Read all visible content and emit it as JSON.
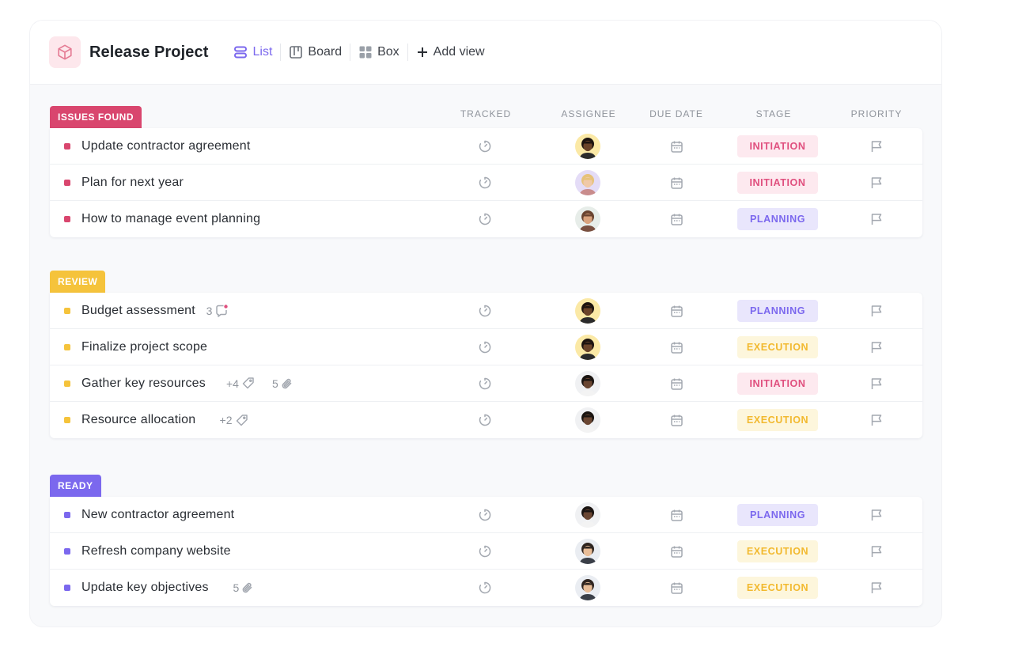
{
  "project": {
    "title": "Release Project"
  },
  "views": [
    {
      "label": "List",
      "icon": "list-icon",
      "active": true
    },
    {
      "label": "Board",
      "icon": "board-icon",
      "active": false
    },
    {
      "label": "Box",
      "icon": "box-icon",
      "active": false
    },
    {
      "label": "Add view",
      "icon": "plus-icon",
      "active": false
    }
  ],
  "columns": {
    "tracked": "TRACKED",
    "assignee": "ASSIGNEE",
    "due_date": "DUE DATE",
    "stage": "STAGE",
    "priority": "PRIORITY"
  },
  "stages": {
    "INITIATION": {
      "fg": "#e04f7e",
      "bg": "#fde9ef"
    },
    "PLANNING": {
      "fg": "#7b68ee",
      "bg": "#e9e6fc"
    },
    "EXECUTION": {
      "fg": "#f2b92f",
      "bg": "#fdf6dc"
    }
  },
  "groups": [
    {
      "label": "ISSUES FOUND",
      "color": "#d9466e",
      "tasks": [
        {
          "name": "Update contractor agreement",
          "stage": "INITIATION",
          "avatar": "avatar-a"
        },
        {
          "name": "Plan for next year",
          "stage": "INITIATION",
          "avatar": "avatar-b"
        },
        {
          "name": "How to manage event planning",
          "stage": "PLANNING",
          "avatar": "avatar-c"
        }
      ]
    },
    {
      "label": "REVIEW",
      "color": "#f5c33b",
      "tasks": [
        {
          "name": "Budget assessment",
          "stage": "PLANNING",
          "avatar": "avatar-a",
          "comments": "3"
        },
        {
          "name": "Finalize project scope",
          "stage": "EXECUTION",
          "avatar": "avatar-a"
        },
        {
          "name": "Gather key resources",
          "stage": "INITIATION",
          "avatar": "avatar-d",
          "tags": "+4",
          "attachments": "5"
        },
        {
          "name": "Resource allocation",
          "stage": "EXECUTION",
          "avatar": "avatar-d",
          "tags": "+2"
        }
      ]
    },
    {
      "label": "READY",
      "color": "#7b68ee",
      "tasks": [
        {
          "name": "New contractor agreement",
          "stage": "PLANNING",
          "avatar": "avatar-d"
        },
        {
          "name": "Refresh company website",
          "stage": "EXECUTION",
          "avatar": "avatar-e"
        },
        {
          "name": "Update key objectives",
          "stage": "EXECUTION",
          "avatar": "avatar-e",
          "attachments": "5"
        }
      ]
    }
  ]
}
